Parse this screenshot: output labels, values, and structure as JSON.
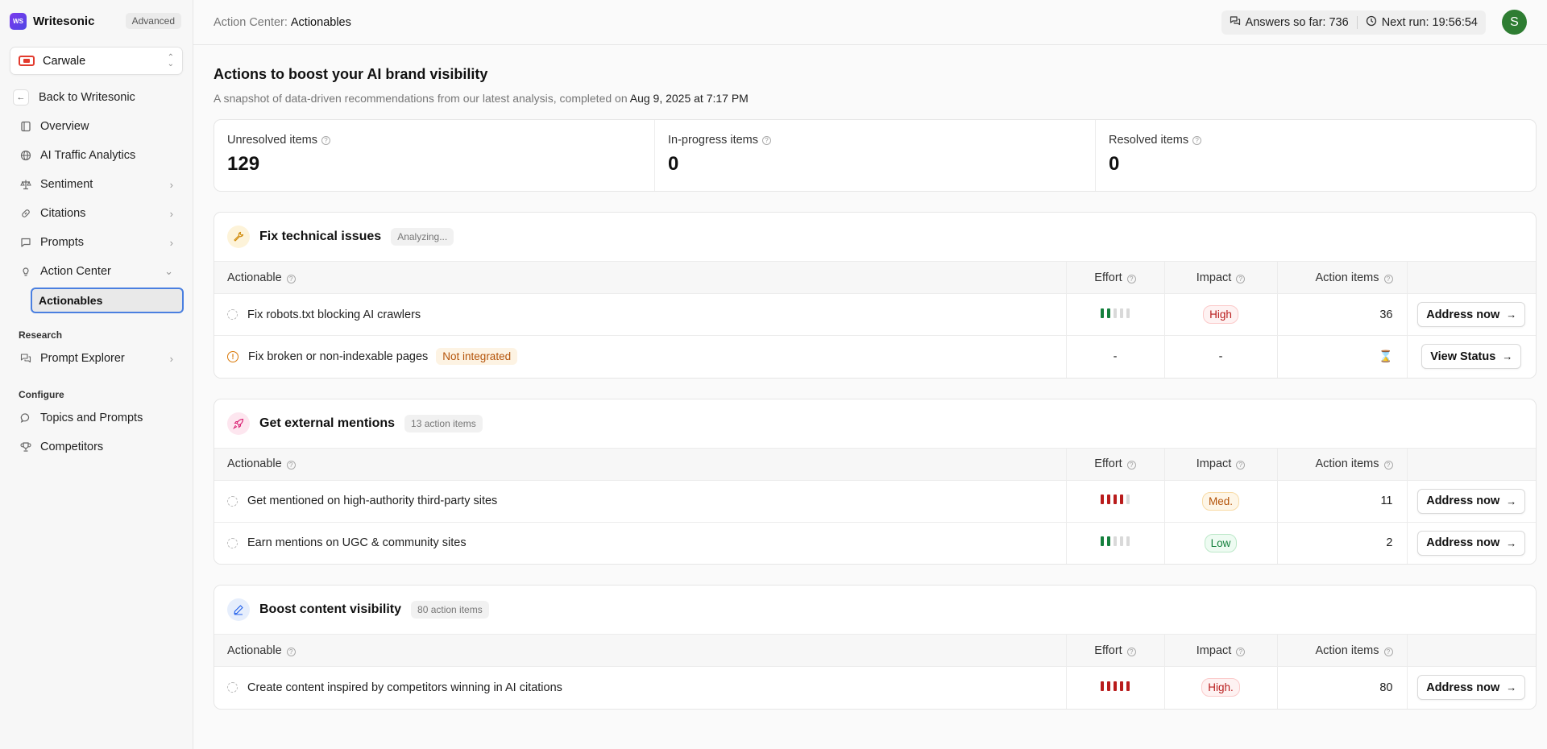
{
  "sidebar": {
    "brand": {
      "logo_text": "WS",
      "name": "Writesonic",
      "tier": "Advanced"
    },
    "project": {
      "name": "Carwale"
    },
    "back_label": "Back to Writesonic",
    "nav": [
      {
        "label": "Overview",
        "icon": "book-icon"
      },
      {
        "label": "AI Traffic Analytics",
        "icon": "globe-icon"
      },
      {
        "label": "Sentiment",
        "icon": "scale-icon"
      },
      {
        "label": "Citations",
        "icon": "link-icon"
      },
      {
        "label": "Prompts",
        "icon": "message-square-icon"
      },
      {
        "label": "Action Center",
        "icon": "lightbulb-icon"
      }
    ],
    "sub_item": "Actionables",
    "research_label": "Research",
    "research_items": [
      {
        "label": "Prompt Explorer",
        "icon": "messages-icon"
      }
    ],
    "configure_label": "Configure",
    "configure_items": [
      {
        "label": "Topics and Prompts",
        "icon": "message-circle-icon"
      },
      {
        "label": "Competitors",
        "icon": "trophy-icon"
      }
    ]
  },
  "topbar": {
    "crumb_prefix": "Action Center:",
    "crumb_current": "Actionables",
    "answers_label": "Answers so far: 736",
    "next_run_label": "Next run: 19:56:54",
    "avatar_initial": "S"
  },
  "page": {
    "title": "Actions to boost your AI brand visibility",
    "subtitle": "A snapshot of data-driven recommendations from our latest analysis, completed on",
    "date": "Aug 9, 2025 at 7:17 PM"
  },
  "summary": [
    {
      "label": "Unresolved items",
      "value": "129"
    },
    {
      "label": "In-progress items",
      "value": "0"
    },
    {
      "label": "Resolved items",
      "value": "0"
    }
  ],
  "columns": {
    "actionable": "Actionable",
    "effort": "Effort",
    "impact": "Impact",
    "items": "Action items"
  },
  "cards": [
    {
      "title": "Fix technical issues",
      "badge": "Analyzing...",
      "icon": "wrench-icon",
      "rows": [
        {
          "name": "Fix robots.txt blocking AI crawlers",
          "effort": 2,
          "effort_color": "green",
          "impact": "High",
          "impact_level": "high",
          "items": "36",
          "action": "Address now"
        },
        {
          "name": "Fix broken or non-indexable pages",
          "tag": "Not integrated",
          "effort_text": "-",
          "impact_text": "-",
          "items_icon": "hourglass-icon",
          "action": "View Status"
        }
      ]
    },
    {
      "title": "Get external mentions",
      "badge": "13 action items",
      "icon": "rocket-icon",
      "rows": [
        {
          "name": "Get mentioned on high-authority third-party sites",
          "effort": 4,
          "effort_color": "red",
          "impact": "Med.",
          "impact_level": "med",
          "items": "11",
          "action": "Address now"
        },
        {
          "name": "Earn mentions on UGC & community sites",
          "effort": 2,
          "effort_color": "green",
          "impact": "Low",
          "impact_level": "low",
          "items": "2",
          "action": "Address now"
        }
      ]
    },
    {
      "title": "Boost content visibility",
      "badge": "80 action items",
      "icon": "pen-icon",
      "rows": [
        {
          "name": "Create content inspired by competitors winning in AI citations",
          "effort": 5,
          "effort_color": "red",
          "impact": "High.",
          "impact_level": "high",
          "items": "80",
          "action": "Address now"
        }
      ]
    }
  ]
}
